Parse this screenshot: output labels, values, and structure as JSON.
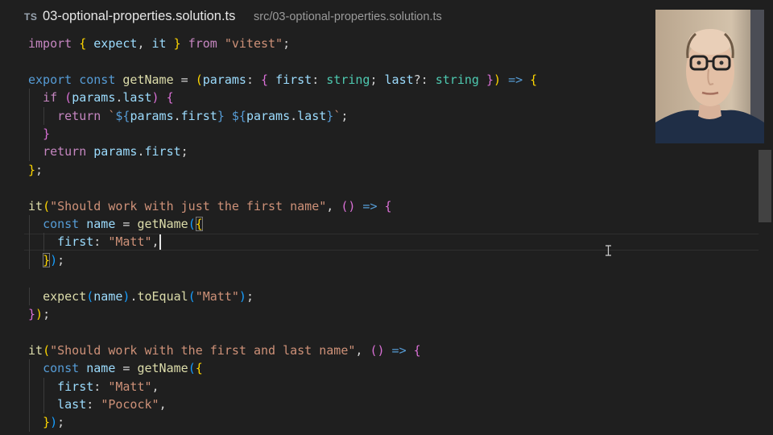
{
  "header": {
    "language_badge": "TS",
    "file_name": "03-optional-properties.solution.ts",
    "file_path": "src/03-optional-properties.solution.ts"
  },
  "code": {
    "lines": [
      [
        [
          "k",
          "import"
        ],
        [
          "p",
          " "
        ],
        [
          "b1",
          "{"
        ],
        [
          "p",
          " "
        ],
        [
          "v",
          "expect"
        ],
        [
          "p",
          ", "
        ],
        [
          "v",
          "it"
        ],
        [
          "p",
          " "
        ],
        [
          "b1",
          "}"
        ],
        [
          "p",
          " "
        ],
        [
          "k",
          "from"
        ],
        [
          "p",
          " "
        ],
        [
          "s",
          "\"vitest\""
        ],
        [
          "p",
          ";"
        ]
      ],
      [],
      [
        [
          "kb",
          "export"
        ],
        [
          "p",
          " "
        ],
        [
          "kb",
          "const"
        ],
        [
          "p",
          " "
        ],
        [
          "f",
          "getName"
        ],
        [
          "p",
          " = "
        ],
        [
          "b1",
          "("
        ],
        [
          "v",
          "params"
        ],
        [
          "p",
          ": "
        ],
        [
          "b2",
          "{"
        ],
        [
          "p",
          " "
        ],
        [
          "v",
          "first"
        ],
        [
          "p",
          ": "
        ],
        [
          "t",
          "string"
        ],
        [
          "p",
          "; "
        ],
        [
          "v",
          "last"
        ],
        [
          "p",
          "?: "
        ],
        [
          "t",
          "string"
        ],
        [
          "p",
          " "
        ],
        [
          "b2",
          "}"
        ],
        [
          "b1",
          ")"
        ],
        [
          "p",
          " "
        ],
        [
          "kb",
          "=>"
        ],
        [
          "p",
          " "
        ],
        [
          "b1",
          "{"
        ]
      ],
      [
        [
          "p",
          "  "
        ],
        [
          "k",
          "if"
        ],
        [
          "p",
          " "
        ],
        [
          "b2",
          "("
        ],
        [
          "v",
          "params"
        ],
        [
          "p",
          "."
        ],
        [
          "v",
          "last"
        ],
        [
          "b2",
          ")"
        ],
        [
          "p",
          " "
        ],
        [
          "b2",
          "{"
        ]
      ],
      [
        [
          "p",
          "    "
        ],
        [
          "k",
          "return"
        ],
        [
          "p",
          " "
        ],
        [
          "s",
          "`"
        ],
        [
          "tb",
          "${"
        ],
        [
          "v",
          "params"
        ],
        [
          "p",
          "."
        ],
        [
          "v",
          "first"
        ],
        [
          "tb",
          "}"
        ],
        [
          "s",
          " "
        ],
        [
          "tb",
          "${"
        ],
        [
          "v",
          "params"
        ],
        [
          "p",
          "."
        ],
        [
          "v",
          "last"
        ],
        [
          "tb",
          "}"
        ],
        [
          "s",
          "`"
        ],
        [
          "p",
          ";"
        ]
      ],
      [
        [
          "p",
          "  "
        ],
        [
          "b2",
          "}"
        ]
      ],
      [
        [
          "p",
          "  "
        ],
        [
          "k",
          "return"
        ],
        [
          "p",
          " "
        ],
        [
          "v",
          "params"
        ],
        [
          "p",
          "."
        ],
        [
          "v",
          "first"
        ],
        [
          "p",
          ";"
        ]
      ],
      [
        [
          "b1",
          "}"
        ],
        [
          "p",
          ";"
        ]
      ],
      [],
      [
        [
          "f",
          "it"
        ],
        [
          "b1",
          "("
        ],
        [
          "s",
          "\"Should work with just the first name\""
        ],
        [
          "p",
          ", "
        ],
        [
          "b2",
          "()"
        ],
        [
          "p",
          " "
        ],
        [
          "kb",
          "=>"
        ],
        [
          "p",
          " "
        ],
        [
          "b2",
          "{"
        ]
      ],
      [
        [
          "p",
          "  "
        ],
        [
          "kb",
          "const"
        ],
        [
          "p",
          " "
        ],
        [
          "v",
          "name"
        ],
        [
          "p",
          " = "
        ],
        [
          "f",
          "getName"
        ],
        [
          "b3",
          "("
        ],
        [
          "b1",
          "{"
        ]
      ],
      [
        [
          "p",
          "    "
        ],
        [
          "v",
          "first"
        ],
        [
          "p",
          ": "
        ],
        [
          "s",
          "\"Matt\""
        ],
        [
          "p",
          ","
        ]
      ],
      [
        [
          "p",
          "  "
        ],
        [
          "b1",
          "}"
        ],
        [
          "b3",
          ")"
        ],
        [
          "p",
          ";"
        ]
      ],
      [],
      [
        [
          "p",
          "  "
        ],
        [
          "f",
          "expect"
        ],
        [
          "b3",
          "("
        ],
        [
          "v",
          "name"
        ],
        [
          "b3",
          ")"
        ],
        [
          "p",
          "."
        ],
        [
          "f",
          "toEqual"
        ],
        [
          "b3",
          "("
        ],
        [
          "s",
          "\"Matt\""
        ],
        [
          "b3",
          ")"
        ],
        [
          "p",
          ";"
        ]
      ],
      [
        [
          "b2",
          "}"
        ],
        [
          "b1",
          ")"
        ],
        [
          "p",
          ";"
        ]
      ],
      [],
      [
        [
          "f",
          "it"
        ],
        [
          "b1",
          "("
        ],
        [
          "s",
          "\"Should work with the first and last name\""
        ],
        [
          "p",
          ", "
        ],
        [
          "b2",
          "()"
        ],
        [
          "p",
          " "
        ],
        [
          "kb",
          "=>"
        ],
        [
          "p",
          " "
        ],
        [
          "b2",
          "{"
        ]
      ],
      [
        [
          "p",
          "  "
        ],
        [
          "kb",
          "const"
        ],
        [
          "p",
          " "
        ],
        [
          "v",
          "name"
        ],
        [
          "p",
          " = "
        ],
        [
          "f",
          "getName"
        ],
        [
          "b3",
          "("
        ],
        [
          "b1",
          "{"
        ]
      ],
      [
        [
          "p",
          "    "
        ],
        [
          "v",
          "first"
        ],
        [
          "p",
          ": "
        ],
        [
          "s",
          "\"Matt\""
        ],
        [
          "p",
          ","
        ]
      ],
      [
        [
          "p",
          "    "
        ],
        [
          "v",
          "last"
        ],
        [
          "p",
          ": "
        ],
        [
          "s",
          "\"Pocock\""
        ],
        [
          "p",
          ","
        ]
      ],
      [
        [
          "p",
          "  "
        ],
        [
          "b1",
          "}"
        ],
        [
          "b3",
          ")"
        ],
        [
          "p",
          ";"
        ]
      ]
    ]
  },
  "editor_state": {
    "current_line_index": 11
  },
  "colors": {
    "background": "#1f1f1f",
    "keyword_control": "#c586c0",
    "keyword_storage": "#569cd6",
    "type": "#4ec9b0",
    "function": "#dcdcaa",
    "variable": "#9cdcfe",
    "string": "#ce9178"
  }
}
